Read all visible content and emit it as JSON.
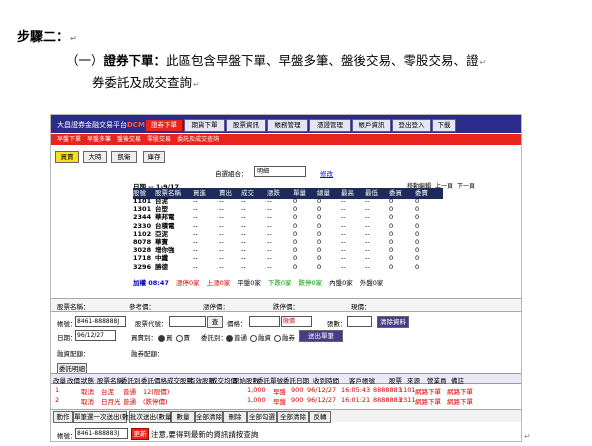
{
  "doc": {
    "step_title": "步驟二：",
    "item_marker": "（一）",
    "item_lead": "證券下單：",
    "item_text_1": "此區包含早盤下單、早盤多筆、盤後交易、零股交易、證",
    "item_text_2": "券委託及成交查詢",
    "return_mark": "↵"
  },
  "screenshot": {
    "logo": "大昌證券金融交易平台",
    "logo_tag": "DCM",
    "tabs": [
      "證券下單",
      "期貨下單",
      "股票資訊",
      "帳務管理",
      "憑證管理",
      "帳戶資訊",
      "登出登入",
      "下載"
    ],
    "subnav": [
      "早盤下單",
      "早盤多筆",
      "盤後交易",
      "零股交易",
      "委託及成交查詢"
    ],
    "quick_buttons": [
      "買賣",
      "大時",
      "凱衛",
      "庫存"
    ],
    "quote_group_label": "自選組合：",
    "quote_group_value": "明細",
    "quote_modify": "修改",
    "quote_nav": [
      "移動編輯",
      "上一頁",
      "下一頁"
    ],
    "quote_date": "日期 -- 1-9/17",
    "quote_columns": [
      "股號",
      "股票名稱",
      "買進",
      "賣出",
      "成交",
      "漲跌",
      "單量",
      "總量",
      "最高",
      "最低",
      "委買",
      "委賣"
    ],
    "quote_rows": [
      {
        "code": "1101",
        "name": "台泥",
        "vol": "0",
        "total": "0",
        "b": "0",
        "s": "0"
      },
      {
        "code": "1301",
        "name": "台塑",
        "vol": "0",
        "total": "0",
        "b": "0",
        "s": "0"
      },
      {
        "code": "2344",
        "name": "華邦電",
        "vol": "0",
        "total": "0",
        "b": "0",
        "s": "0"
      },
      {
        "code": "2330",
        "name": "台積電",
        "vol": "0",
        "total": "0",
        "b": "0",
        "s": "0"
      },
      {
        "code": "1102",
        "name": "亞泥",
        "vol": "0",
        "total": "0",
        "b": "0",
        "s": "0"
      },
      {
        "code": "8078",
        "name": "華寶",
        "vol": "0",
        "total": "0",
        "b": "0",
        "s": "0"
      },
      {
        "code": "3028",
        "name": "增你強",
        "vol": "0",
        "total": "0",
        "b": "0",
        "s": "0"
      },
      {
        "code": "1718",
        "name": "中纖",
        "vol": "0",
        "total": "0",
        "b": "0",
        "s": "0"
      },
      {
        "code": "3296",
        "name": "勝德",
        "vol": "0",
        "total": "0",
        "b": "0",
        "s": "0"
      }
    ],
    "dash": "--",
    "stats": [
      "加權 08:47",
      "漲停0家",
      "上漲0家",
      "平盤0家",
      "下跌0家",
      "跌停0家",
      "內盤0家",
      "外盤0家"
    ],
    "info_labels": [
      "股票名稱：",
      "參考價：",
      "漲停價：",
      "跌停價：",
      "現價："
    ],
    "form": {
      "account_label": "帳號：",
      "account_value": "8461-888888J",
      "code_label": "股票代號：",
      "code_btn": "查",
      "price_label": "價格：",
      "price_type": "限價",
      "qty_label": "張數：",
      "date_label": "日期：",
      "date_value": "96/12/27",
      "side_label": "買賣別：",
      "side_options": [
        "買",
        "賣"
      ],
      "type_label": "委託別：",
      "type_options": [
        "普通",
        "融資",
        "融券"
      ],
      "submit_btn": "送出單筆",
      "clear_btn": "清除資料",
      "credit_label": "融資配額：",
      "short_label": "融券配額："
    },
    "order_section_label": "委託明細",
    "order_columns": [
      "改量",
      "改價",
      "狀態",
      "股票名稱",
      "委託別",
      "委託價格",
      "成交股數",
      "有效股數",
      "成交均價",
      "原始股數",
      "委託單號",
      "委託日期",
      "收到時間",
      "客戶帳號",
      "股票",
      "來源",
      "營業員",
      "備註"
    ],
    "orders": [
      {
        "n": "1",
        "status": "取消",
        "name": "台泥",
        "type": "普通",
        "price": "12(限價)",
        "qty": "1,000",
        "kind": "早盤",
        "num": "900",
        "date": "96/12/27",
        "time": "16:05:43",
        "acct": "8888883",
        "stock": "1101",
        "src": "網路下單",
        "agent": "網路下單"
      },
      {
        "n": "2",
        "status": "取消",
        "name": "日月光",
        "type": "普通",
        "price": "(跌停價)",
        "qty": "1,000",
        "kind": "早盤",
        "num": "900",
        "date": "96/12/27",
        "time": "16:01:21",
        "acct": "8888883",
        "stock": "2311",
        "src": "網路下單",
        "agent": "網路下單"
      }
    ],
    "cancel_bar": [
      "動作",
      "單筆選一次送出(數量)",
      "批次送出(數量)",
      "數量",
      "全部清除",
      "刪除",
      "全部勾選",
      "全部清除",
      "反轉"
    ],
    "footer_account_label": "帳號：",
    "footer_account": "8461-888883J",
    "footer_badge": "更新",
    "footer_note": "注意,要得到最新的資訊請按查詢",
    "colors": {
      "nav": "#2b2b8c",
      "accent": "#e8241c",
      "header": "#1c2a5c"
    }
  }
}
